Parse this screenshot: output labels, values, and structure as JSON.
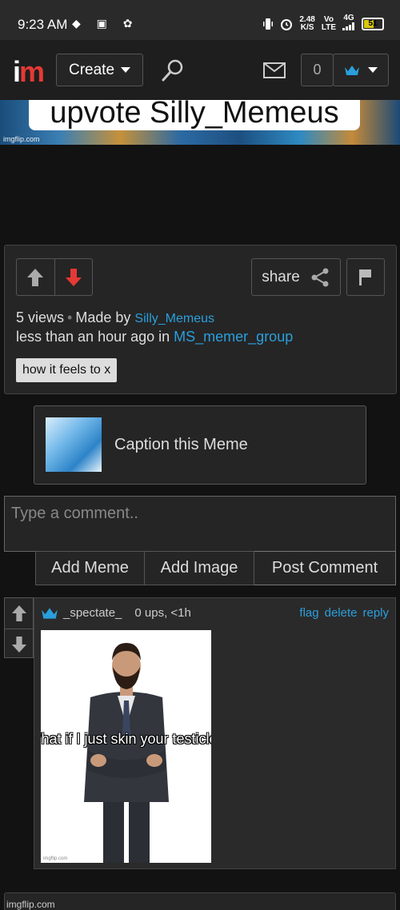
{
  "statusbar": {
    "time": "9:23 AM",
    "left_icons": "◆ ▣ ✿",
    "speed_value": "2.48",
    "speed_unit": "K/S",
    "volte_top": "Vo",
    "volte_bottom": "LTE",
    "network": "4G",
    "battery_level": "51"
  },
  "header": {
    "logo_i": "i",
    "logo_m": "m",
    "create_label": "Create",
    "notification_count": "0"
  },
  "banner": {
    "text": "upvote Silly_Memeus",
    "watermark": "imgflip.com"
  },
  "post": {
    "share_label": "share",
    "views": "5 views",
    "made_by_prefix": "Made by",
    "author": "Silly_Memeus",
    "time_prefix": "less than an hour ago in",
    "stream": "MS_memer_group",
    "tag": "how it feels to x"
  },
  "caption_box": {
    "label": "Caption this Meme"
  },
  "comment_form": {
    "placeholder": "Type a comment..",
    "add_meme": "Add Meme",
    "add_image": "Add Image",
    "post_comment": "Post Comment"
  },
  "comment": {
    "username": "_spectate_",
    "ups": "0 ups, <1h",
    "actions": [
      "flag",
      "delete",
      "reply"
    ],
    "image_caption": "What if I just skin your testicles",
    "image_watermark": "imgflip.com"
  },
  "footer": {
    "text": "imgflip.com"
  },
  "colors": {
    "link": "#2a9fdc",
    "downvote_active": "#e53935",
    "logo_m": "#e53935",
    "crown": "#2a9fdc"
  }
}
